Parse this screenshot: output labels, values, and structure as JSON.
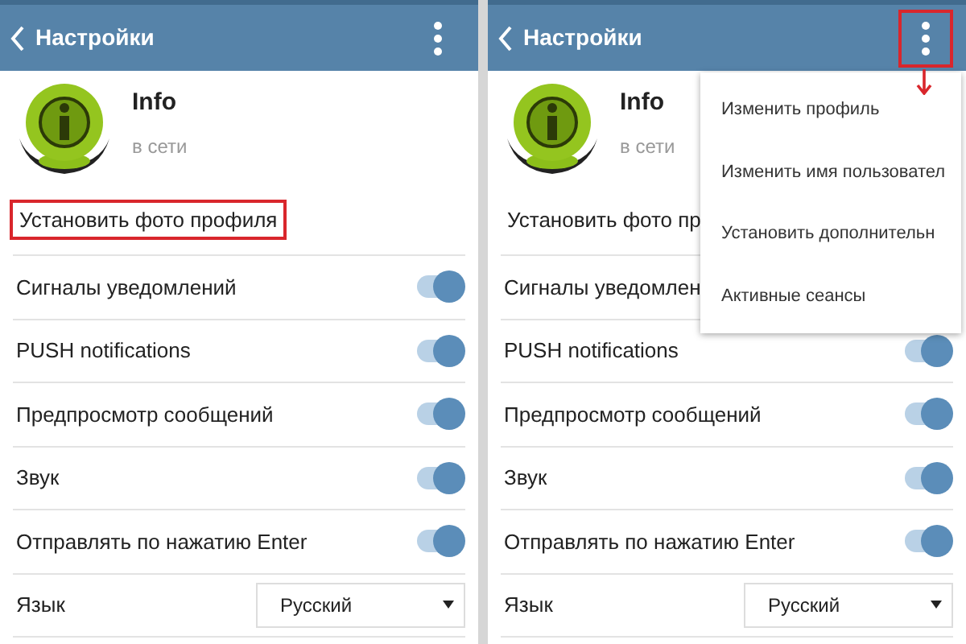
{
  "screens": [
    {
      "header": {
        "title": "Настройки",
        "menu_highlighted": false
      },
      "profile": {
        "name": "Info",
        "status": "в сети"
      },
      "set_photo": {
        "label": "Установить фото профиля",
        "highlighted": true
      },
      "settings": [
        {
          "kind": "toggle",
          "label": "Сигналы уведомлений",
          "on": true
        },
        {
          "kind": "toggle",
          "label": "PUSH notifications",
          "on": true
        },
        {
          "kind": "toggle",
          "label": "Предпросмотр сообщений",
          "on": true
        },
        {
          "kind": "toggle",
          "label": "Звук",
          "on": true
        },
        {
          "kind": "toggle",
          "label": "Отправлять по нажатию Enter",
          "on": true
        },
        {
          "kind": "select",
          "label": "Язык",
          "value": "Русский"
        }
      ]
    },
    {
      "header": {
        "title": "Настройки",
        "menu_highlighted": true
      },
      "profile": {
        "name": "Info",
        "status": "в сети"
      },
      "set_photo": {
        "label": "Установить фото пр",
        "highlighted": false
      },
      "settings": [
        {
          "kind": "plain",
          "label": "Сигналы уведомлен"
        },
        {
          "kind": "toggle",
          "label": "PUSH notifications",
          "on": true
        },
        {
          "kind": "toggle",
          "label": "Предпросмотр сообщений",
          "on": true
        },
        {
          "kind": "toggle",
          "label": "Звук",
          "on": true
        },
        {
          "kind": "toggle",
          "label": "Отправлять по нажатию Enter",
          "on": true
        },
        {
          "kind": "select",
          "label": "Язык",
          "value": "Русский"
        }
      ],
      "menu": [
        "Изменить профиль",
        "Изменить имя пользовател",
        "Установить дополнительн",
        "Активные сеансы"
      ]
    }
  ]
}
